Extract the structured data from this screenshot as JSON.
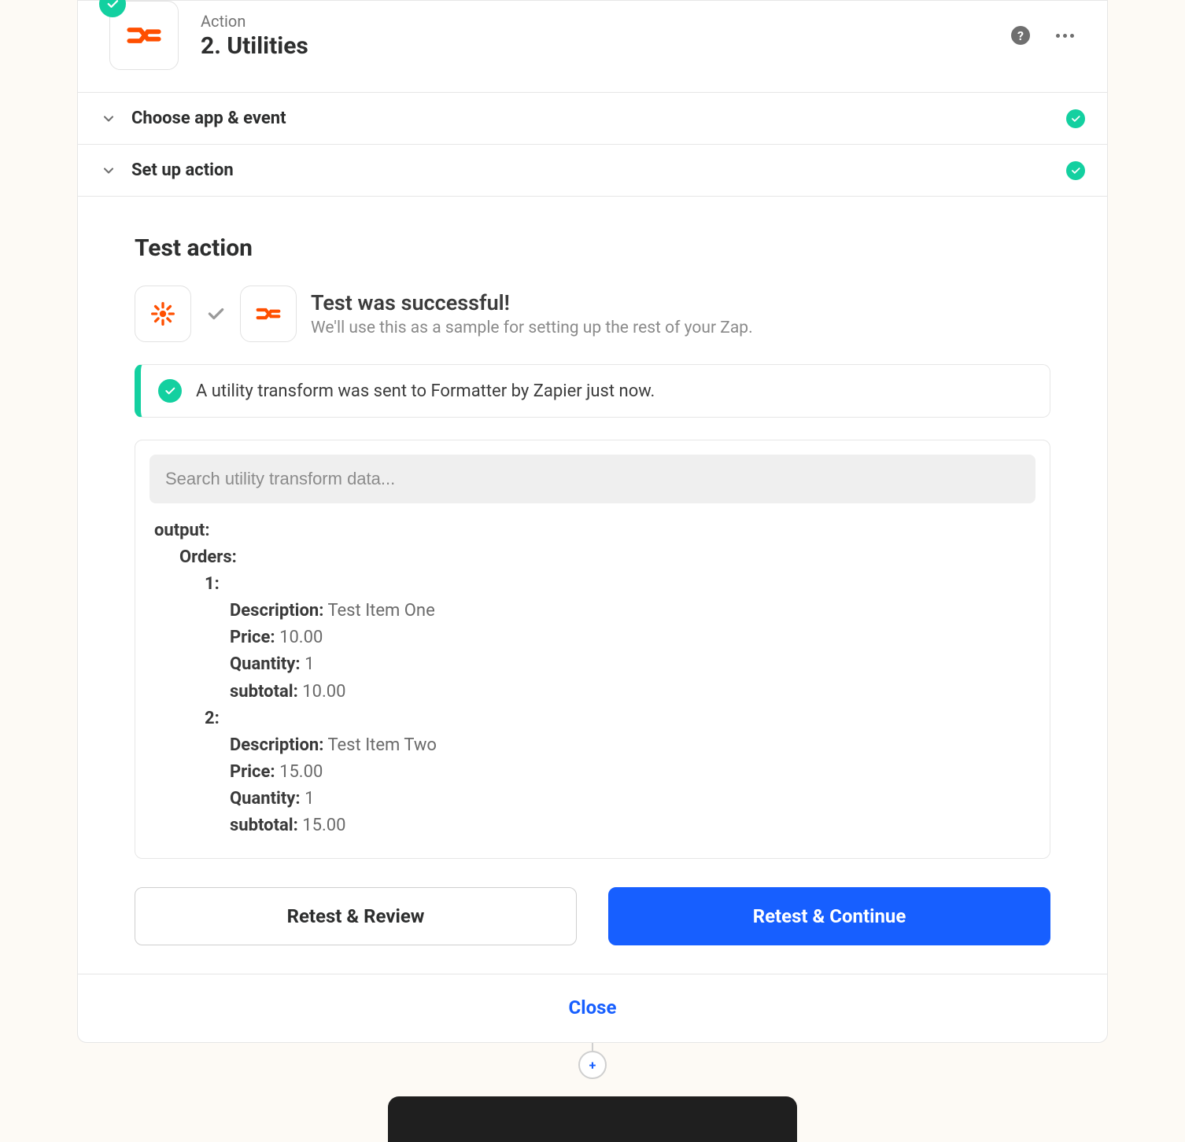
{
  "header": {
    "kicker": "Action",
    "title": "2. Utilities"
  },
  "sections": {
    "choose": "Choose app & event",
    "setup": "Set up action",
    "test": "Test action"
  },
  "test": {
    "success_title": "Test was successful!",
    "success_sub": "We'll use this as a sample for setting up the rest of your Zap.",
    "banner": "A utility transform was sent to Formatter by Zapier just now."
  },
  "search": {
    "placeholder": "Search utility transform data..."
  },
  "output": {
    "root": "output:",
    "orders": "Orders:",
    "items": [
      {
        "idx": "1:",
        "Description": "Test Item One",
        "Price": "10.00",
        "Quantity": "1",
        "subtotal": "10.00"
      },
      {
        "idx": "2:",
        "Description": "Test Item Two",
        "Price": "15.00",
        "Quantity": "1",
        "subtotal": "15.00"
      }
    ]
  },
  "labels": {
    "description": "Description:",
    "price": "Price:",
    "quantity": "Quantity:",
    "subtotal": "subtotal:"
  },
  "buttons": {
    "retest_review": "Retest & Review",
    "retest_continue": "Retest & Continue",
    "close": "Close"
  }
}
